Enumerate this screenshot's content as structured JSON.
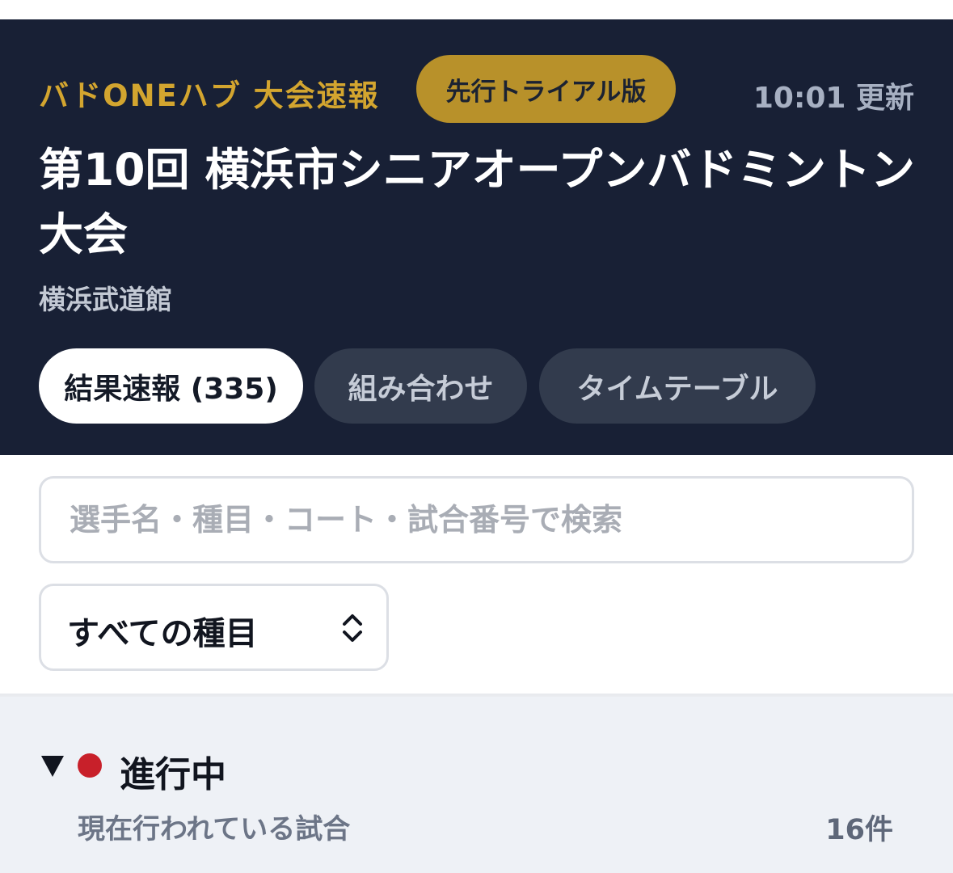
{
  "header": {
    "brand": "バドONEハブ 大会速報",
    "badge": "先行トライアル版",
    "updated": "10:01 更新",
    "title": "第10回 横浜市シニアオープンバドミントン大会",
    "venue": "横浜武道館"
  },
  "tabs": [
    {
      "label": "結果速報 (335)",
      "active": true
    },
    {
      "label": "組み合わせ",
      "active": false
    },
    {
      "label": "タイムテーブル",
      "active": false
    }
  ],
  "search": {
    "placeholder": "選手名・種目・コート・試合番号で検索",
    "value": ""
  },
  "event_filter": {
    "selected": "すべての種目"
  },
  "sections": [
    {
      "title": "進行中",
      "subtitle": "現在行われている試合",
      "count": "16件",
      "collapsed_icon": "triangle-down-icon",
      "status_color": "#c8202a"
    }
  ],
  "colors": {
    "header_bg": "#182035",
    "brand_gold": "#d3a52f",
    "badge_bg": "#b8912a",
    "live_red": "#c8202a",
    "section_bg": "#eef1f6"
  }
}
